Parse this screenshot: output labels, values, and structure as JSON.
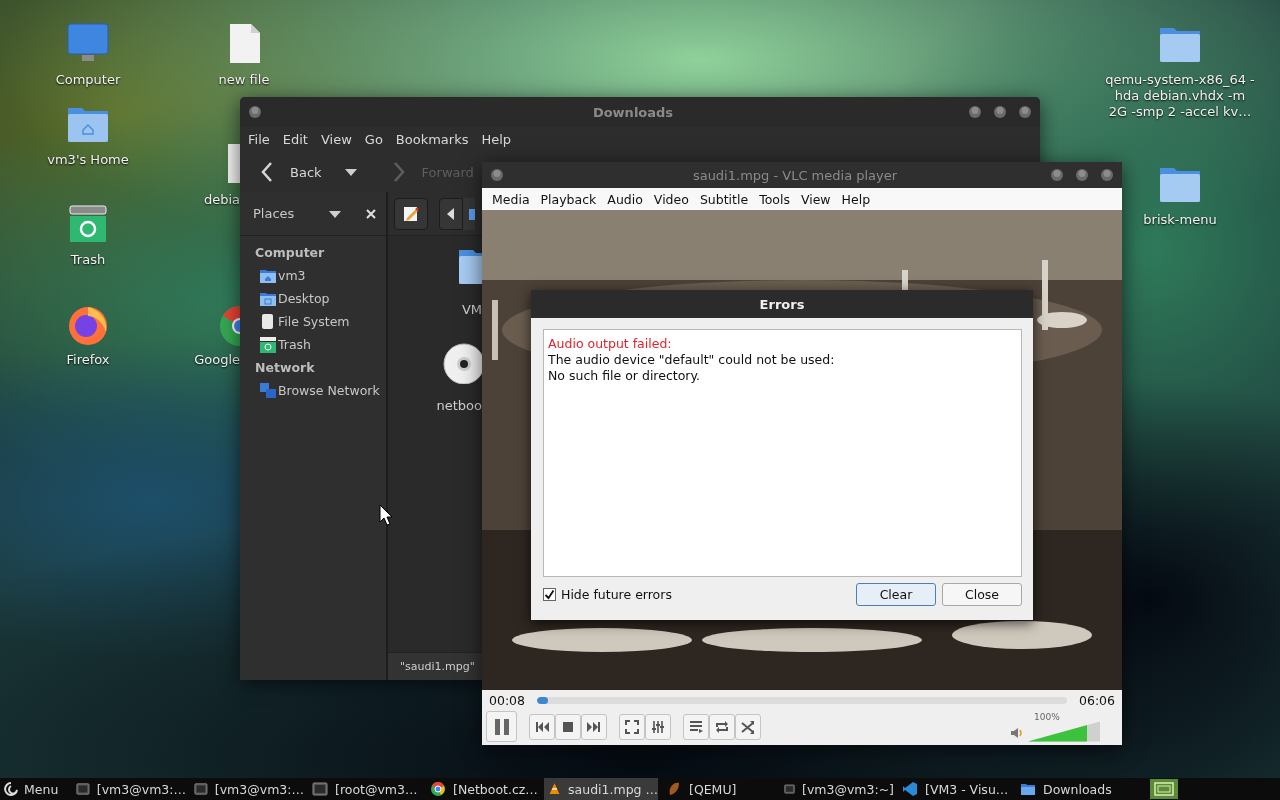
{
  "desktop": {
    "icons": [
      {
        "label": "Computer",
        "kind": "monitor"
      },
      {
        "label": "new file",
        "kind": "file"
      },
      {
        "label": "vm3's Home",
        "kind": "home"
      },
      {
        "label": "debia",
        "kind": "file"
      },
      {
        "label": "Trash",
        "kind": "trash"
      },
      {
        "label": "Firefox",
        "kind": "firefox"
      },
      {
        "label": "Google",
        "kind": "chrome"
      },
      {
        "label": "qemu-system-x86_64 -hda debian.vhdx -m 2G -smp 2 -accel kv…",
        "kind": "folder"
      },
      {
        "label": "brisk-menu",
        "kind": "folder"
      }
    ]
  },
  "file_manager": {
    "title": "Downloads",
    "menu": [
      "File",
      "Edit",
      "View",
      "Go",
      "Bookmarks",
      "Help"
    ],
    "toolbar": [
      {
        "label": "Back",
        "disabled": false
      },
      {
        "label": "Forward",
        "disabled": true
      }
    ],
    "sidebar": {
      "title": "Places",
      "sections": [
        {
          "heading": "Computer",
          "items": [
            {
              "label": "vm3",
              "kind": "home"
            },
            {
              "label": "Desktop",
              "kind": "desktop"
            },
            {
              "label": "File System",
              "kind": "drive"
            },
            {
              "label": "Trash",
              "kind": "trash"
            }
          ]
        },
        {
          "heading": "Network",
          "items": [
            {
              "label": "Browse Network",
              "kind": "network"
            }
          ]
        }
      ]
    },
    "files": [
      {
        "label": "VM",
        "kind": "folder"
      },
      {
        "label": "netboo",
        "kind": "disc"
      }
    ],
    "status": "\"saudi1.mpg\""
  },
  "vlc": {
    "title": "saudi1.mpg - VLC media player",
    "menu": [
      "Media",
      "Playback",
      "Audio",
      "Video",
      "Subtitle",
      "Tools",
      "View",
      "Help"
    ],
    "errors_dialog": {
      "title": "Errors",
      "messages": [
        {
          "text": "Audio output failed:",
          "kind": "error"
        },
        {
          "text": "The audio device \"default\" could not be used:",
          "kind": "detail"
        },
        {
          "text": "No such file or directory.",
          "kind": "detail"
        }
      ],
      "hide_future": {
        "label": "Hide future errors",
        "checked": true
      },
      "buttons": [
        {
          "label": "Clear",
          "default": true
        },
        {
          "label": "Close",
          "default": false
        }
      ]
    },
    "player": {
      "elapsed": "00:08",
      "total": "06:06",
      "seek": {
        "level": 0.02
      },
      "playing": true,
      "volume": {
        "reading": "100%",
        "level": 0.82
      }
    }
  },
  "taskbar": {
    "menu": "Menu",
    "tasks": [
      {
        "label": "[vm3@vm3:…",
        "kind": "terminal",
        "selected": false
      },
      {
        "label": "[vm3@vm3:…",
        "kind": "terminal",
        "selected": false
      },
      {
        "label": "[root@vm3…",
        "kind": "terminal",
        "selected": false
      },
      {
        "label": "[Netboot.cz…",
        "kind": "browser",
        "selected": false
      },
      {
        "label": "saudi1.mpg …",
        "kind": "player",
        "selected": true
      },
      {
        "label": "[QEMU]",
        "kind": "emulator",
        "selected": false
      },
      {
        "label": "[vm3@vm3:~]",
        "kind": "terminal",
        "selected": false
      },
      {
        "label": "[VM3 - Visu…",
        "kind": "editor",
        "selected": false
      },
      {
        "label": "Downloads",
        "kind": "files",
        "selected": false
      }
    ]
  }
}
